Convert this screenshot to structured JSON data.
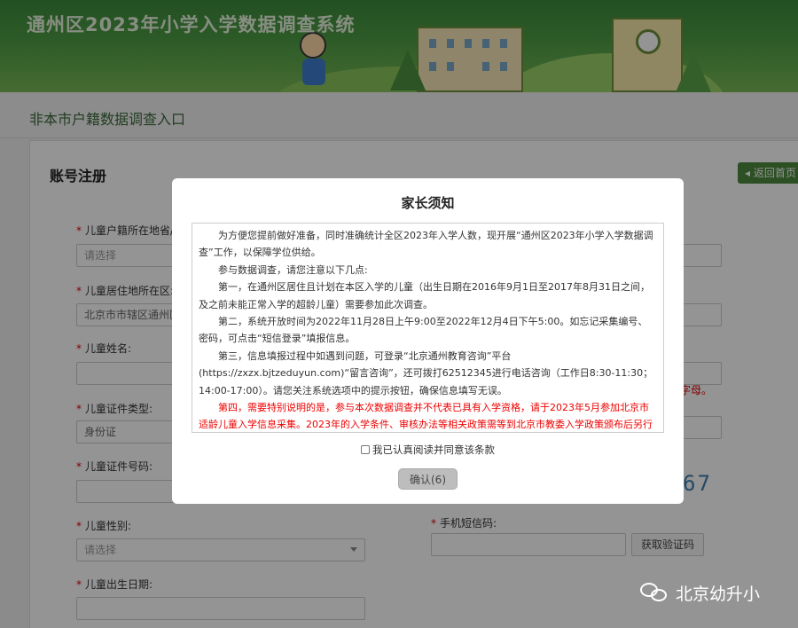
{
  "header": {
    "site_title": "通州区2023年小学入学数据调查系统"
  },
  "breadcrumb": {
    "text": "非本市户籍数据调查入口"
  },
  "panel": {
    "title": "账号注册",
    "back_button": "返回首页",
    "fields": {
      "huji": {
        "label": "儿童户籍所在地省/自",
        "placeholder": "请选择"
      },
      "juzhu": {
        "label": "儿童居住地所在区:",
        "value": "北京市市辖区通州区"
      },
      "name": {
        "label": "儿童姓名:"
      },
      "id_type": {
        "label": "儿童证件类型:",
        "value": "身份证"
      },
      "id_no": {
        "label": "儿童证件号码:"
      },
      "gender": {
        "label": "儿童性别:",
        "placeholder": "请选择"
      },
      "birth": {
        "label": "儿童出生日期:"
      },
      "sms": {
        "label": "手机短信码:",
        "button": "获取验证码"
      }
    },
    "red_fragment": "字母。",
    "captcha_fragment": "67"
  },
  "modal": {
    "title": "家长须知",
    "paragraphs": [
      "为方便您提前做好准备，同时准确统计全区2023年入学人数，现开展“通州区2023年小学入学数据调查”工作，以保障学位供给。",
      "参与数据调查，请您注意以下几点:",
      "第一，在通州区居住且计划在本区入学的儿童（出生日期在2016年9月1日至2017年8月31日之间，及之前未能正常入学的超龄儿童）需要参加此次调查。",
      "第二，系统开放时间为2022年11月28日上午9:00至2022年12月4日下午5:00。如忘记采集编号、密码，可点击“短信登录”填报信息。",
      "第三，信息填报过程中如遇到问题，可登录“北京通州教育咨询”平台(https://zxzx.bjtzeduyun.com)“留言咨询”，还可拨打62512345进行电话咨询（工作日8:30-11:30；14:00-17:00）。请您关注系统选项中的提示按钮，确保信息填写无误。"
    ],
    "red_paragraph": "第四，需要特别说明的是，参与本次数据调查并不代表已具有入学资格，请于2023年5月参加北京市适龄儿童入学信息采集。2023年的入学条件、审核办法等相关政策需等到北京市教委入学政策颁布后另行发布。",
    "agree_label": "我已认真阅读并同意该条款",
    "confirm_button": "确认(6)"
  },
  "watermark": {
    "text": "北京幼升小"
  }
}
